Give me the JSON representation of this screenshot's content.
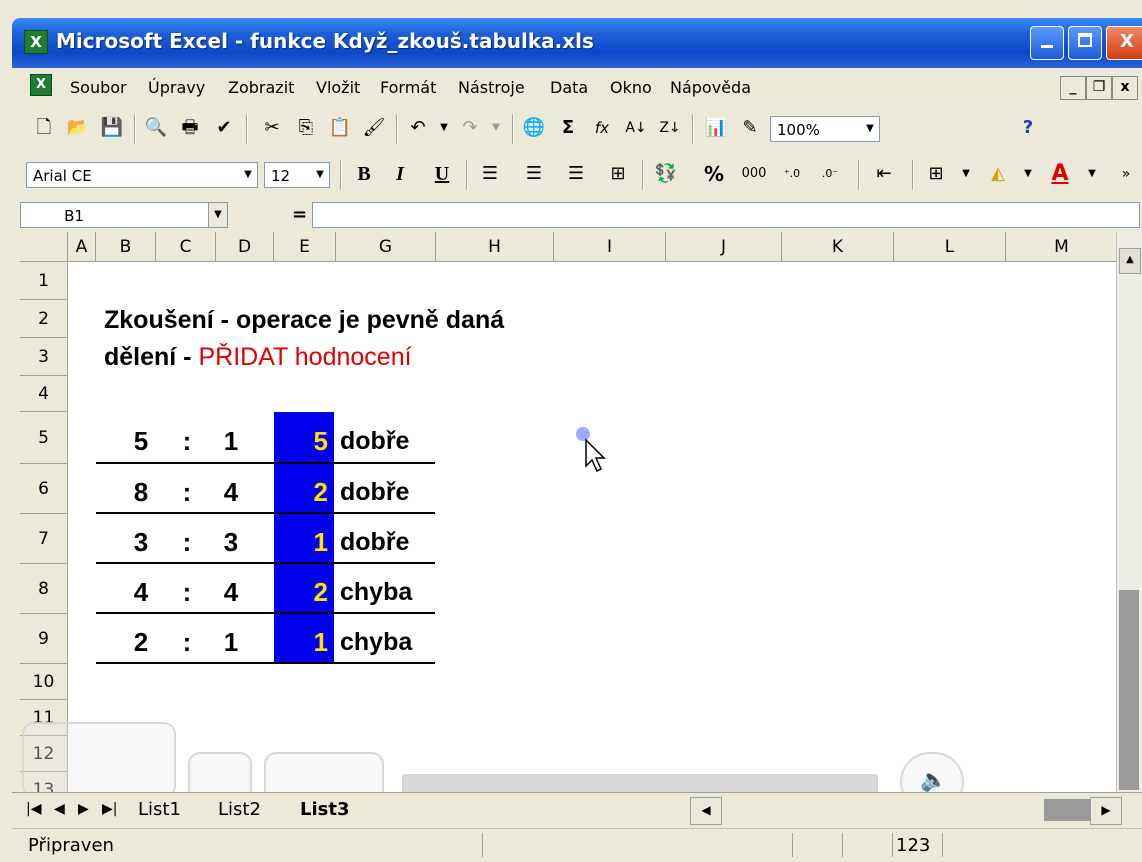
{
  "window": {
    "title": "Microsoft Excel - funkce Když_zkouš.tabulka.xls",
    "controls": {
      "minimize": "_",
      "maximize": "□",
      "close": "X"
    }
  },
  "menu": {
    "items": [
      "Soubor",
      "Úpravy",
      "Zobrazit",
      "Vložit",
      "Formát",
      "Nástroje",
      "Data",
      "Okno",
      "Nápověda"
    ]
  },
  "toolbar_standard": {
    "zoom": "100%"
  },
  "toolbar_format": {
    "font_name": "Arial CE",
    "font_size": "12",
    "bold": "B",
    "italic": "I",
    "underline": "U",
    "percent": "%",
    "thousands": "000"
  },
  "formula_bar": {
    "name_box": "B1",
    "equals": "=",
    "content": ""
  },
  "columns": [
    "A",
    "B",
    "C",
    "D",
    "E",
    "G",
    "H",
    "I",
    "J",
    "K",
    "L",
    "M"
  ],
  "rows": [
    "1",
    "2",
    "3",
    "4",
    "5",
    "6",
    "7",
    "8",
    "9",
    "10",
    "11",
    "12",
    "13"
  ],
  "sheet": {
    "heading_line1": "Zkoušení - operace je pevně daná",
    "heading_line2_black": "dělení - ",
    "heading_line2_red": "PŘIDAT hodnocení",
    "entries": [
      {
        "a": "5",
        "sep": ":",
        "b": "1",
        "result": "5",
        "rating": "dobře"
      },
      {
        "a": "8",
        "sep": ":",
        "b": "4",
        "result": "2",
        "rating": "dobře"
      },
      {
        "a": "3",
        "sep": ":",
        "b": "3",
        "result": "1",
        "rating": "dobře"
      },
      {
        "a": "4",
        "sep": ":",
        "b": "4",
        "result": "2",
        "rating": "chyba"
      },
      {
        "a": "2",
        "sep": ":",
        "b": "1",
        "result": "1",
        "rating": "chyba"
      }
    ]
  },
  "sheet_tabs": [
    "List1",
    "List2",
    "List3"
  ],
  "active_tab": "List3",
  "status": {
    "ready": "Připraven",
    "num": "123"
  },
  "colors": {
    "accent_red": "#E00000",
    "result_fill": "#0000EE",
    "result_text": "#FFE000",
    "titlebar": "#0A48C8"
  }
}
